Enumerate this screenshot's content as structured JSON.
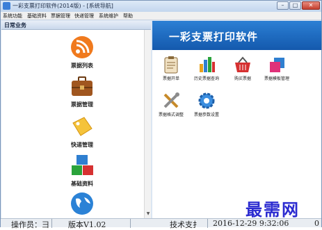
{
  "window": {
    "title": "一彩支票打印软件(2014版) - [系统导航]"
  },
  "controls": {
    "minimize": "–",
    "maximize": "□",
    "close": "✕"
  },
  "menu": [
    "系统功能",
    "基础资料",
    "票据管理",
    "快递管理",
    "系统维护",
    "帮助"
  ],
  "left_panel": {
    "header": "日常业务",
    "items": [
      {
        "label": "票据列表",
        "icon": "rss-icon"
      },
      {
        "label": "票据管理",
        "icon": "briefcase-icon"
      },
      {
        "label": "快递管理",
        "icon": "tag-icon"
      },
      {
        "label": "基础资料",
        "icon": "blocks-icon"
      },
      {
        "label": "",
        "icon": "globe-icon"
      }
    ]
  },
  "right_panel": {
    "banner": "一彩支票打印软件",
    "functions": [
      {
        "label": "票据开单",
        "icon": "clipboard-icon"
      },
      {
        "label": "历史票据查询",
        "icon": "bar-chart-icon"
      },
      {
        "label": "购买票据",
        "icon": "basket-icon"
      },
      {
        "label": "票据模板管理",
        "icon": "template-icon"
      },
      {
        "label": "票据格式调整",
        "icon": "tools-icon"
      },
      {
        "label": "票据参数设置",
        "icon": "gear-icon"
      }
    ]
  },
  "status_bar": {
    "operator": "操作员：⺕",
    "version": "版本V1.02",
    "support": "技术支扌",
    "datetime": "2016-12-29 9:32:06",
    "extra": "0"
  },
  "watermark": "最需网",
  "colors": {
    "banner": "#1f6cc4",
    "accent_red": "#c4402f"
  }
}
